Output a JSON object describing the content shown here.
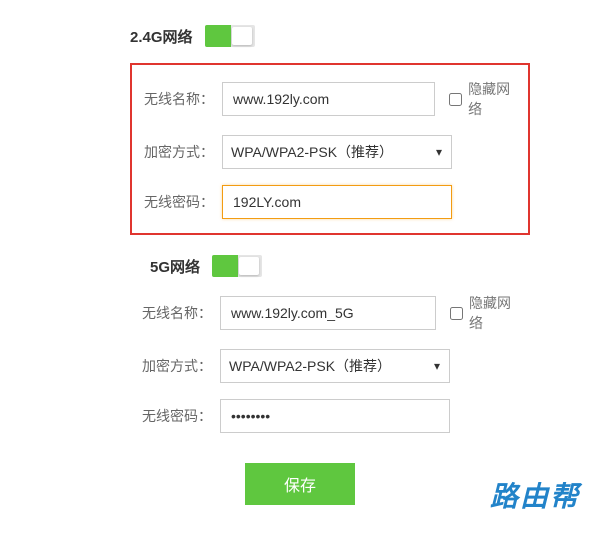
{
  "network24": {
    "title": "2.4G网络",
    "toggle_on": true,
    "ssid_label": "无线名称：",
    "ssid_value": "www.192ly.com",
    "hide_label": "隐藏网络",
    "encryption_label": "加密方式：",
    "encryption_value": "WPA/WPA2-PSK（推荐）",
    "password_label": "无线密码：",
    "password_value": "192LY.com"
  },
  "network5g": {
    "title": "5G网络",
    "toggle_on": true,
    "ssid_label": "无线名称：",
    "ssid_value": "www.192ly.com_5G",
    "hide_label": "隐藏网络",
    "encryption_label": "加密方式：",
    "encryption_value": "WPA/WPA2-PSK（推荐）",
    "password_label": "无线密码：",
    "password_value": "••••••••"
  },
  "actions": {
    "save_label": "保存"
  },
  "watermark": "路由帮"
}
